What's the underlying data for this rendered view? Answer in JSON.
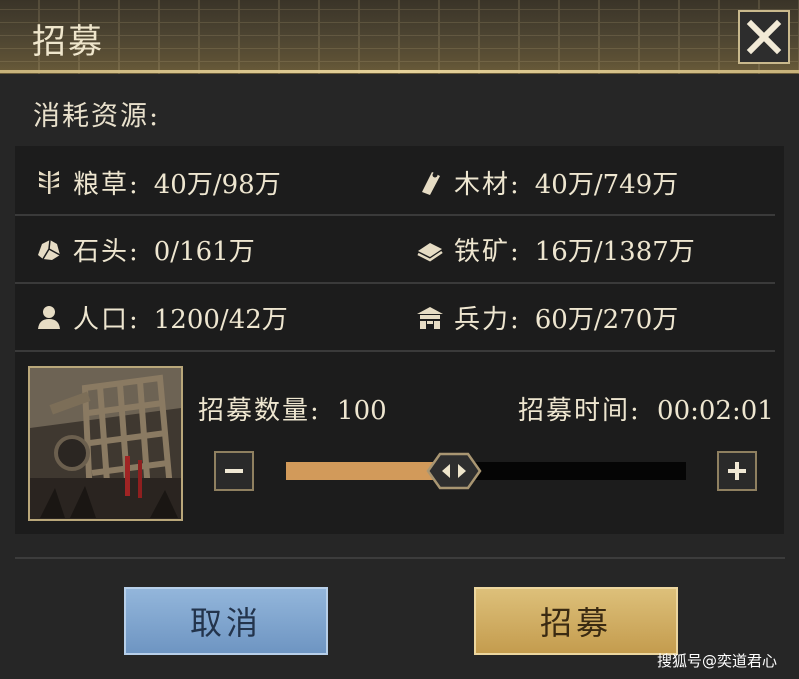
{
  "dialog": {
    "title": "招募",
    "section_label": "消耗资源:"
  },
  "resources": [
    {
      "icon": "wheat-icon",
      "label": "粮草:",
      "value": "40万/98万"
    },
    {
      "icon": "wood-icon",
      "label": "木材:",
      "value": "40万/749万"
    },
    {
      "icon": "stone-icon",
      "label": "石头:",
      "value": "0/161万"
    },
    {
      "icon": "iron-ore-icon",
      "label": "铁矿:",
      "value": "16万/1387万"
    },
    {
      "icon": "population-icon",
      "label": "人口:",
      "value": "1200/42万"
    },
    {
      "icon": "troops-icon",
      "label": "兵力:",
      "value": "60万/270万"
    }
  ],
  "recruit": {
    "quantity_label": "招募数量:",
    "quantity_value": "100",
    "time_label": "招募时间:",
    "time_value": "00:02:01",
    "slider_fraction": 0.42
  },
  "buttons": {
    "cancel": "取消",
    "confirm": "招募"
  },
  "watermark": "搜狐号@奕道君心",
  "colors": {
    "accent_gold": "#c9b98d",
    "slider_fill": "#d29a5a",
    "cancel_button": "#7fa5cf",
    "confirm_button": "#d4b266"
  }
}
